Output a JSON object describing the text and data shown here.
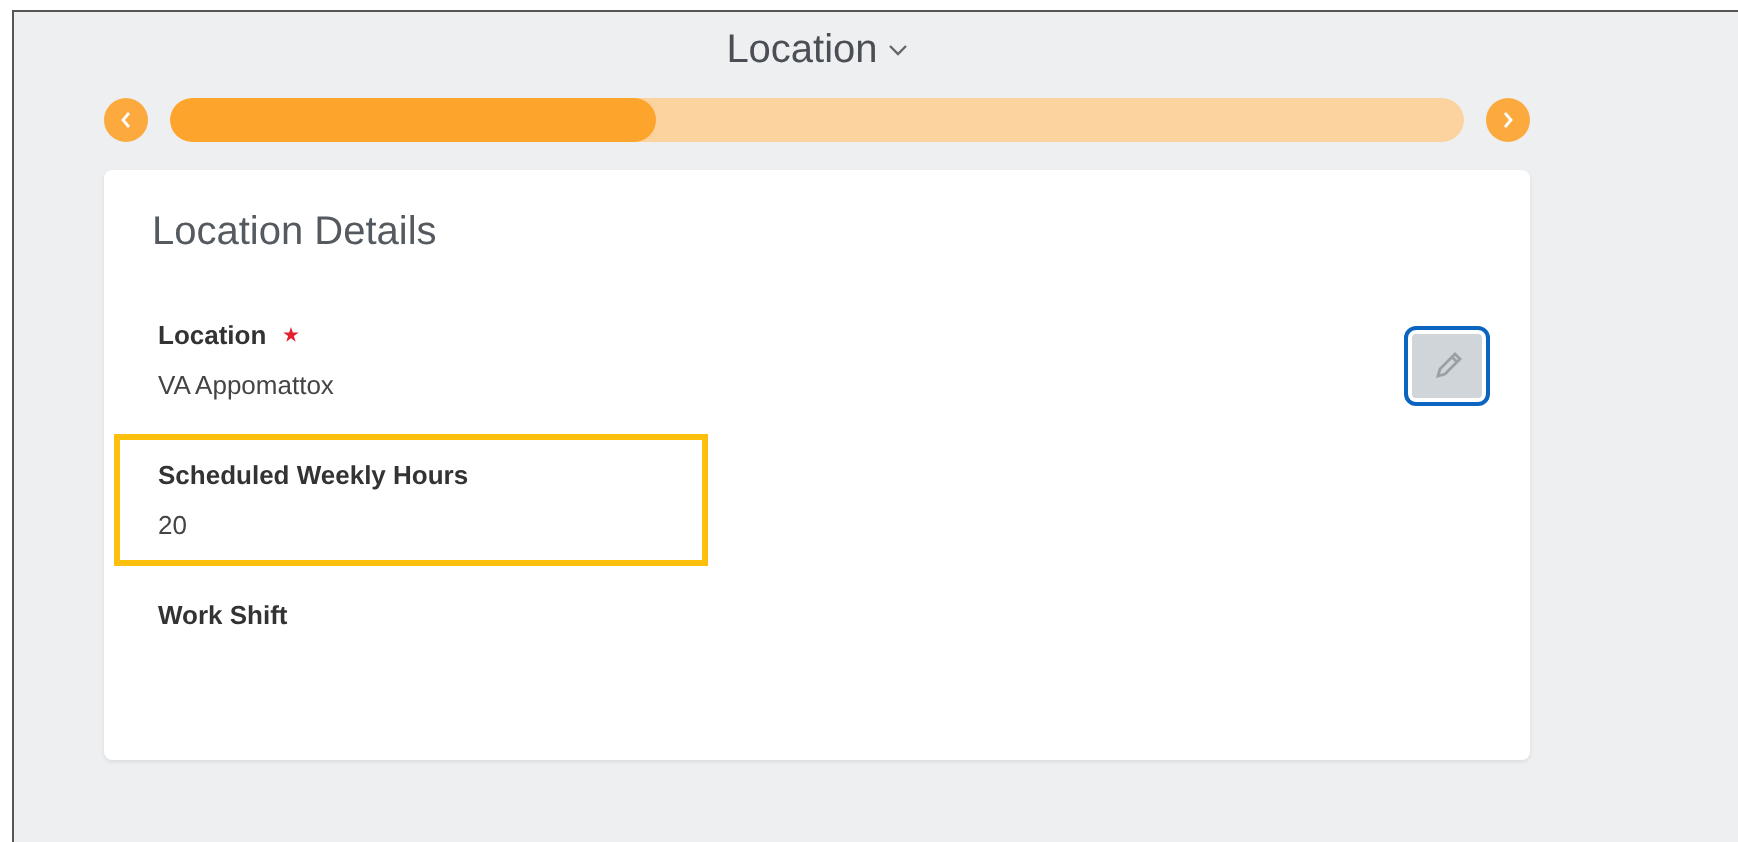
{
  "header": {
    "title": "Location"
  },
  "progress": {
    "level": 0.375
  },
  "card": {
    "title": "Location Details",
    "fields": [
      {
        "label": "Location",
        "required": true,
        "value": "VA Appomattox",
        "editable": true
      },
      {
        "label": "Scheduled Weekly Hours",
        "value": "20",
        "highlighted": true
      },
      {
        "label": "Work Shift"
      }
    ]
  }
}
